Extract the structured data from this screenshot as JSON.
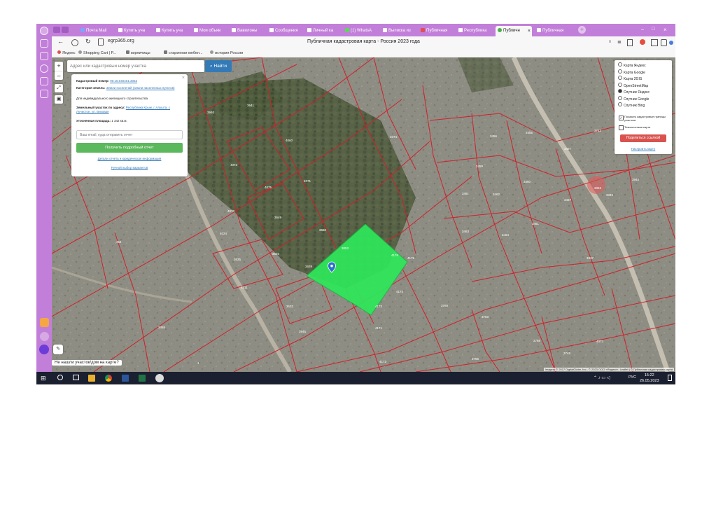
{
  "browser": {
    "tabs": [
      {
        "label": "Почта Mail"
      },
      {
        "label": "Купить уча"
      },
      {
        "label": "Купить уча"
      },
      {
        "label": "Мои объяв"
      },
      {
        "label": "Вавилоны"
      },
      {
        "label": "Сообщения"
      },
      {
        "label": "Личный ка"
      },
      {
        "label": "(1) WhatsA"
      },
      {
        "label": "Выписка из"
      },
      {
        "label": "Публичная"
      },
      {
        "label": "Республика"
      },
      {
        "label": "Публичн"
      },
      {
        "label": "Публичная"
      }
    ],
    "page_title": "Публичная кадастровая карта - Россия 2023 года",
    "url": "egrp365.org",
    "bookmarks": [
      "Яндекс",
      "Shopping Cart | P...",
      "кирпичицы",
      "старинная мебел...",
      "история России"
    ]
  },
  "search": {
    "placeholder": "Адрес или кадастровый номер участка",
    "button_label": "Найти"
  },
  "info_panel": {
    "cadastral_label": "Кадастровый номер:",
    "cadastral_value": "90:15:040401:3053",
    "category_label": "Категория земель:",
    "category_value": "Земли поселений (земли населенных пунктов)",
    "usage": "Для индивидуального жилищного строительства",
    "address_label": "Земельный участок по адресу:",
    "address_value": "Республика Крым, г Алушта, с Лучистое, ул. Виковая",
    "area_label": "Уточненная площадь:",
    "area_value": "1 342 кв.м.",
    "email_placeholder": "Ваш email, куда отправить отчет",
    "report_button": "Получить подробный отчет",
    "details_link": "Детали отчета и юридическая информация",
    "manual_link": "Ручной выбор вариантов"
  },
  "layer_panel": {
    "options": [
      "Карта Яндекс",
      "Карта Google",
      "Карта 2GIS",
      "OpenStreetMap",
      "Спутник Яндекс",
      "Спутник Google",
      "Спутник Bing"
    ],
    "selected": "Спутник Яндекс",
    "checkbox_cadastral": "Показать кадастровые границы участков",
    "checkbox_thematic": "Тематическая карта",
    "share_button": "Поделиться ссылкой",
    "settings_link": "Настроить карту"
  },
  "map": {
    "parcel_labels": [
      "3940",
      "3641",
      "4060",
      "4074",
      "4073",
      "4075",
      "4071",
      "4070",
      "3649",
      "3650",
      "3640",
      "3639",
      "3635",
      "4034",
      "3632",
      "4211",
      "4176",
      "4175",
      "4174",
      "4172",
      "4171",
      "3456",
      "3455",
      "3457",
      "3459",
      "3461",
      "3462",
      "3460",
      "3467",
      "3463",
      "3464",
      "3461",
      "3346",
      "3345",
      "3944",
      "3743",
      "3337",
      "3760",
      "3753",
      "3768",
      "3755",
      "3749",
      "4073",
      "4172",
      "3945",
      "3347",
      "454",
      "3455",
      "1"
    ],
    "selected_parcel_label": "3053",
    "attribution": "Imagery © 2017 DigitalGlobe, Inc., © 2023 ООО «Яндекс», Leaflet | © Публичная кадастровая карта"
  },
  "not_found_prompt": "Не нашли участок/дом на карте?",
  "taskbar": {
    "lang": "РУС",
    "time": "15:22",
    "date": "26.05.2023"
  },
  "colors": {
    "browser_accent": "#c27fd9",
    "parcel_border": "#d0202a",
    "selected_parcel": "#2ee85a",
    "terrain": "#8d8c82"
  }
}
